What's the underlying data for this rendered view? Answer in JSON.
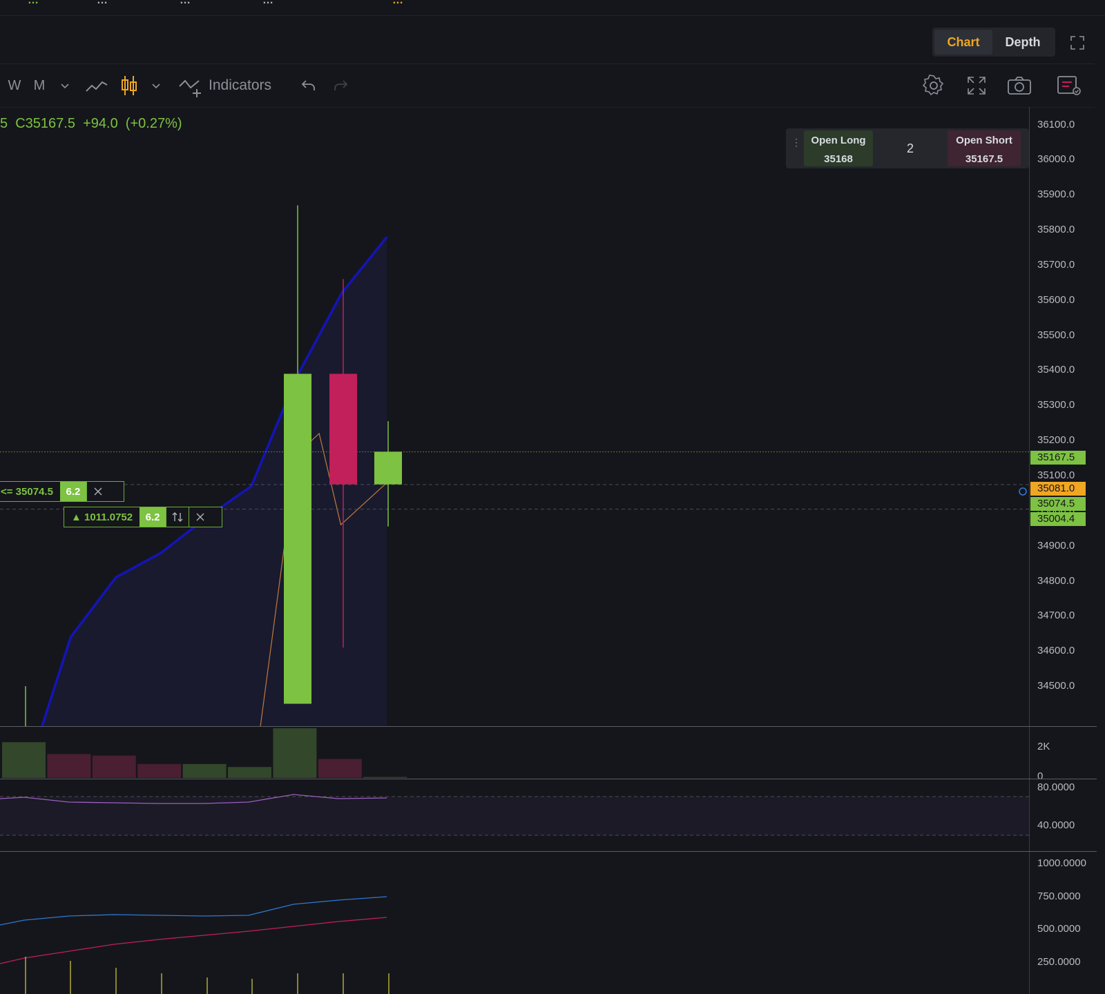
{
  "header": {
    "partial_stats": [
      {
        "label": "…",
        "color": "green"
      },
      {
        "label": "…",
        "color": "normal"
      },
      {
        "label": "…",
        "color": "normal"
      },
      {
        "label": "…",
        "color": "normal"
      },
      {
        "label": "…",
        "color": "orange"
      }
    ]
  },
  "view_tabs": {
    "chart": "Chart",
    "depth": "Depth",
    "active": "Chart"
  },
  "toolbar": {
    "interval_w": "W",
    "interval_m": "M",
    "indicators_label": "Indicators",
    "icons": [
      "chevron-down-icon",
      "line-chart-icon",
      "candlestick-icon",
      "indicators-icon",
      "undo-icon",
      "redo-icon",
      "settings-icon",
      "fullscreen-icon",
      "camera-icon",
      "trade-panel-icon"
    ]
  },
  "ohlc_readout": "5  C35167.5  +94.0  (+0.27%)",
  "trade_panel": {
    "open_long_label": "Open Long",
    "open_long_price": "35168",
    "quantity": "2",
    "open_short_label": "Open Short",
    "open_short_price": "35167.5"
  },
  "price_axis": {
    "ticks": [
      "36100.0",
      "36000.0",
      "35900.0",
      "35800.0",
      "35700.0",
      "35600.0",
      "35500.0",
      "35400.0",
      "35300.0",
      "35200.0",
      "35100.0",
      "35000.0",
      "34900.0",
      "34800.0",
      "34700.0",
      "34600.0",
      "34500.0"
    ]
  },
  "price_labels": {
    "last": {
      "value": "35167.5",
      "color": "#7dc242"
    },
    "mark": {
      "value": "35081.0",
      "color": "#f0a623"
    },
    "order1": {
      "value": "35074.5",
      "color": "#7dc242"
    },
    "order2": {
      "value": "35004.4",
      "color": "#7dc242"
    }
  },
  "orders": {
    "order1": {
      "text": "<= 35074.5",
      "qty": "6.2"
    },
    "order2": {
      "text": "▲ 1011.0752",
      "qty": "6.2"
    }
  },
  "volume_axis": {
    "ticks": [
      "2K",
      "0"
    ]
  },
  "osc1_axis": {
    "ticks": [
      "80.0000",
      "40.0000"
    ]
  },
  "osc2_axis": {
    "ticks": [
      "1000.0000",
      "750.0000",
      "500.0000",
      "250.0000"
    ]
  },
  "colors": {
    "up": "#7dc242",
    "down": "#c2205a",
    "ma": "#1414b8",
    "accent": "#f0a623",
    "background": "#15161b"
  },
  "chart_data": {
    "type": "candlestick",
    "candles": [
      {
        "open": 34450,
        "high": 35870,
        "low": 34450,
        "close": 35390,
        "dir": "up"
      },
      {
        "open": 35390,
        "high": 35660,
        "low": 34610,
        "close": 35075,
        "dir": "down"
      },
      {
        "open": 35075,
        "high": 35255,
        "low": 34955,
        "close": 35168,
        "dir": "up"
      }
    ],
    "ma_line": [
      {
        "x": 0,
        "y": 34240
      },
      {
        "x": 1,
        "y": 34640
      },
      {
        "x": 2,
        "y": 34810
      },
      {
        "x": 3,
        "y": 34880
      },
      {
        "x": 4,
        "y": 34980
      },
      {
        "x": 5,
        "y": 35070
      },
      {
        "x": 6,
        "y": 35380
      },
      {
        "x": 7,
        "y": 35620
      },
      {
        "x": 8,
        "y": 35780
      }
    ],
    "ylim": [
      34420,
      36150
    ],
    "volume": [
      {
        "v": 0.72,
        "dir": "up"
      },
      {
        "v": 0.48,
        "dir": "down"
      },
      {
        "v": 0.45,
        "dir": "down"
      },
      {
        "v": 0.28,
        "dir": "down"
      },
      {
        "v": 0.28,
        "dir": "up"
      },
      {
        "v": 0.22,
        "dir": "up"
      },
      {
        "v": 1.0,
        "dir": "up"
      },
      {
        "v": 0.38,
        "dir": "down"
      },
      {
        "v": 0.02,
        "dir": "up"
      }
    ]
  }
}
